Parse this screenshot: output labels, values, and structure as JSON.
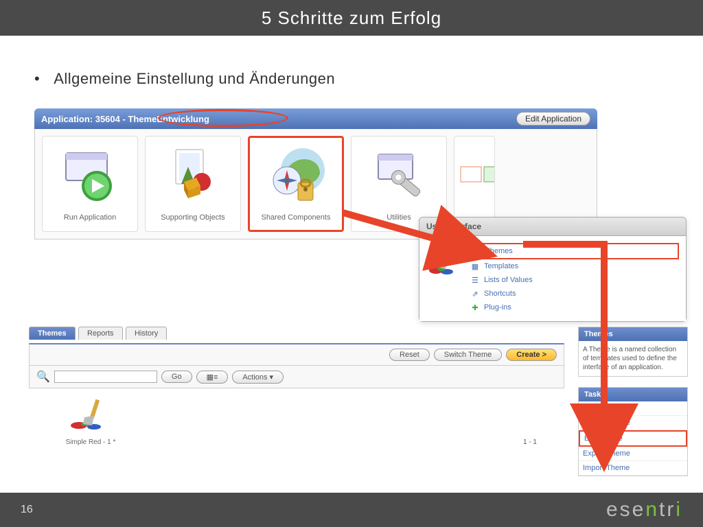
{
  "header": {
    "title": "5 Schritte zum Erfolg"
  },
  "bullet": "Allgemeine Einstellung und Änderungen",
  "appbar": {
    "label": "Application: 35604 - ThemeEntwicklung",
    "edit": "Edit Application"
  },
  "tiles": {
    "run": "Run Application",
    "supporting": "Supporting Objects",
    "shared": "Shared Components",
    "utilities": "Utilities"
  },
  "ui_panel": {
    "title": "User Interface",
    "items": [
      "Themes",
      "Templates",
      "Lists of Values",
      "Shortcuts",
      "Plug-ins"
    ]
  },
  "tabs": {
    "themes": "Themes",
    "reports": "Reports",
    "history": "History"
  },
  "toolbar": {
    "reset": "Reset",
    "switch": "Switch Theme",
    "create": "Create >"
  },
  "search": {
    "go": "Go",
    "actions": "Actions ▾"
  },
  "theme_item": "Simple Red - 1 *",
  "pagination": "1 - 1",
  "side_themes": {
    "head": "Themes",
    "body": "A Theme is a named collection of templates used to define the interface of an application."
  },
  "side_tasks": {
    "head": "Tasks",
    "items": [
      "Copy Theme",
      "Delete Theme",
      "Edit Theme",
      "Export Theme",
      "Import Theme"
    ]
  },
  "footer": {
    "page": "16",
    "brand": "esentri"
  }
}
